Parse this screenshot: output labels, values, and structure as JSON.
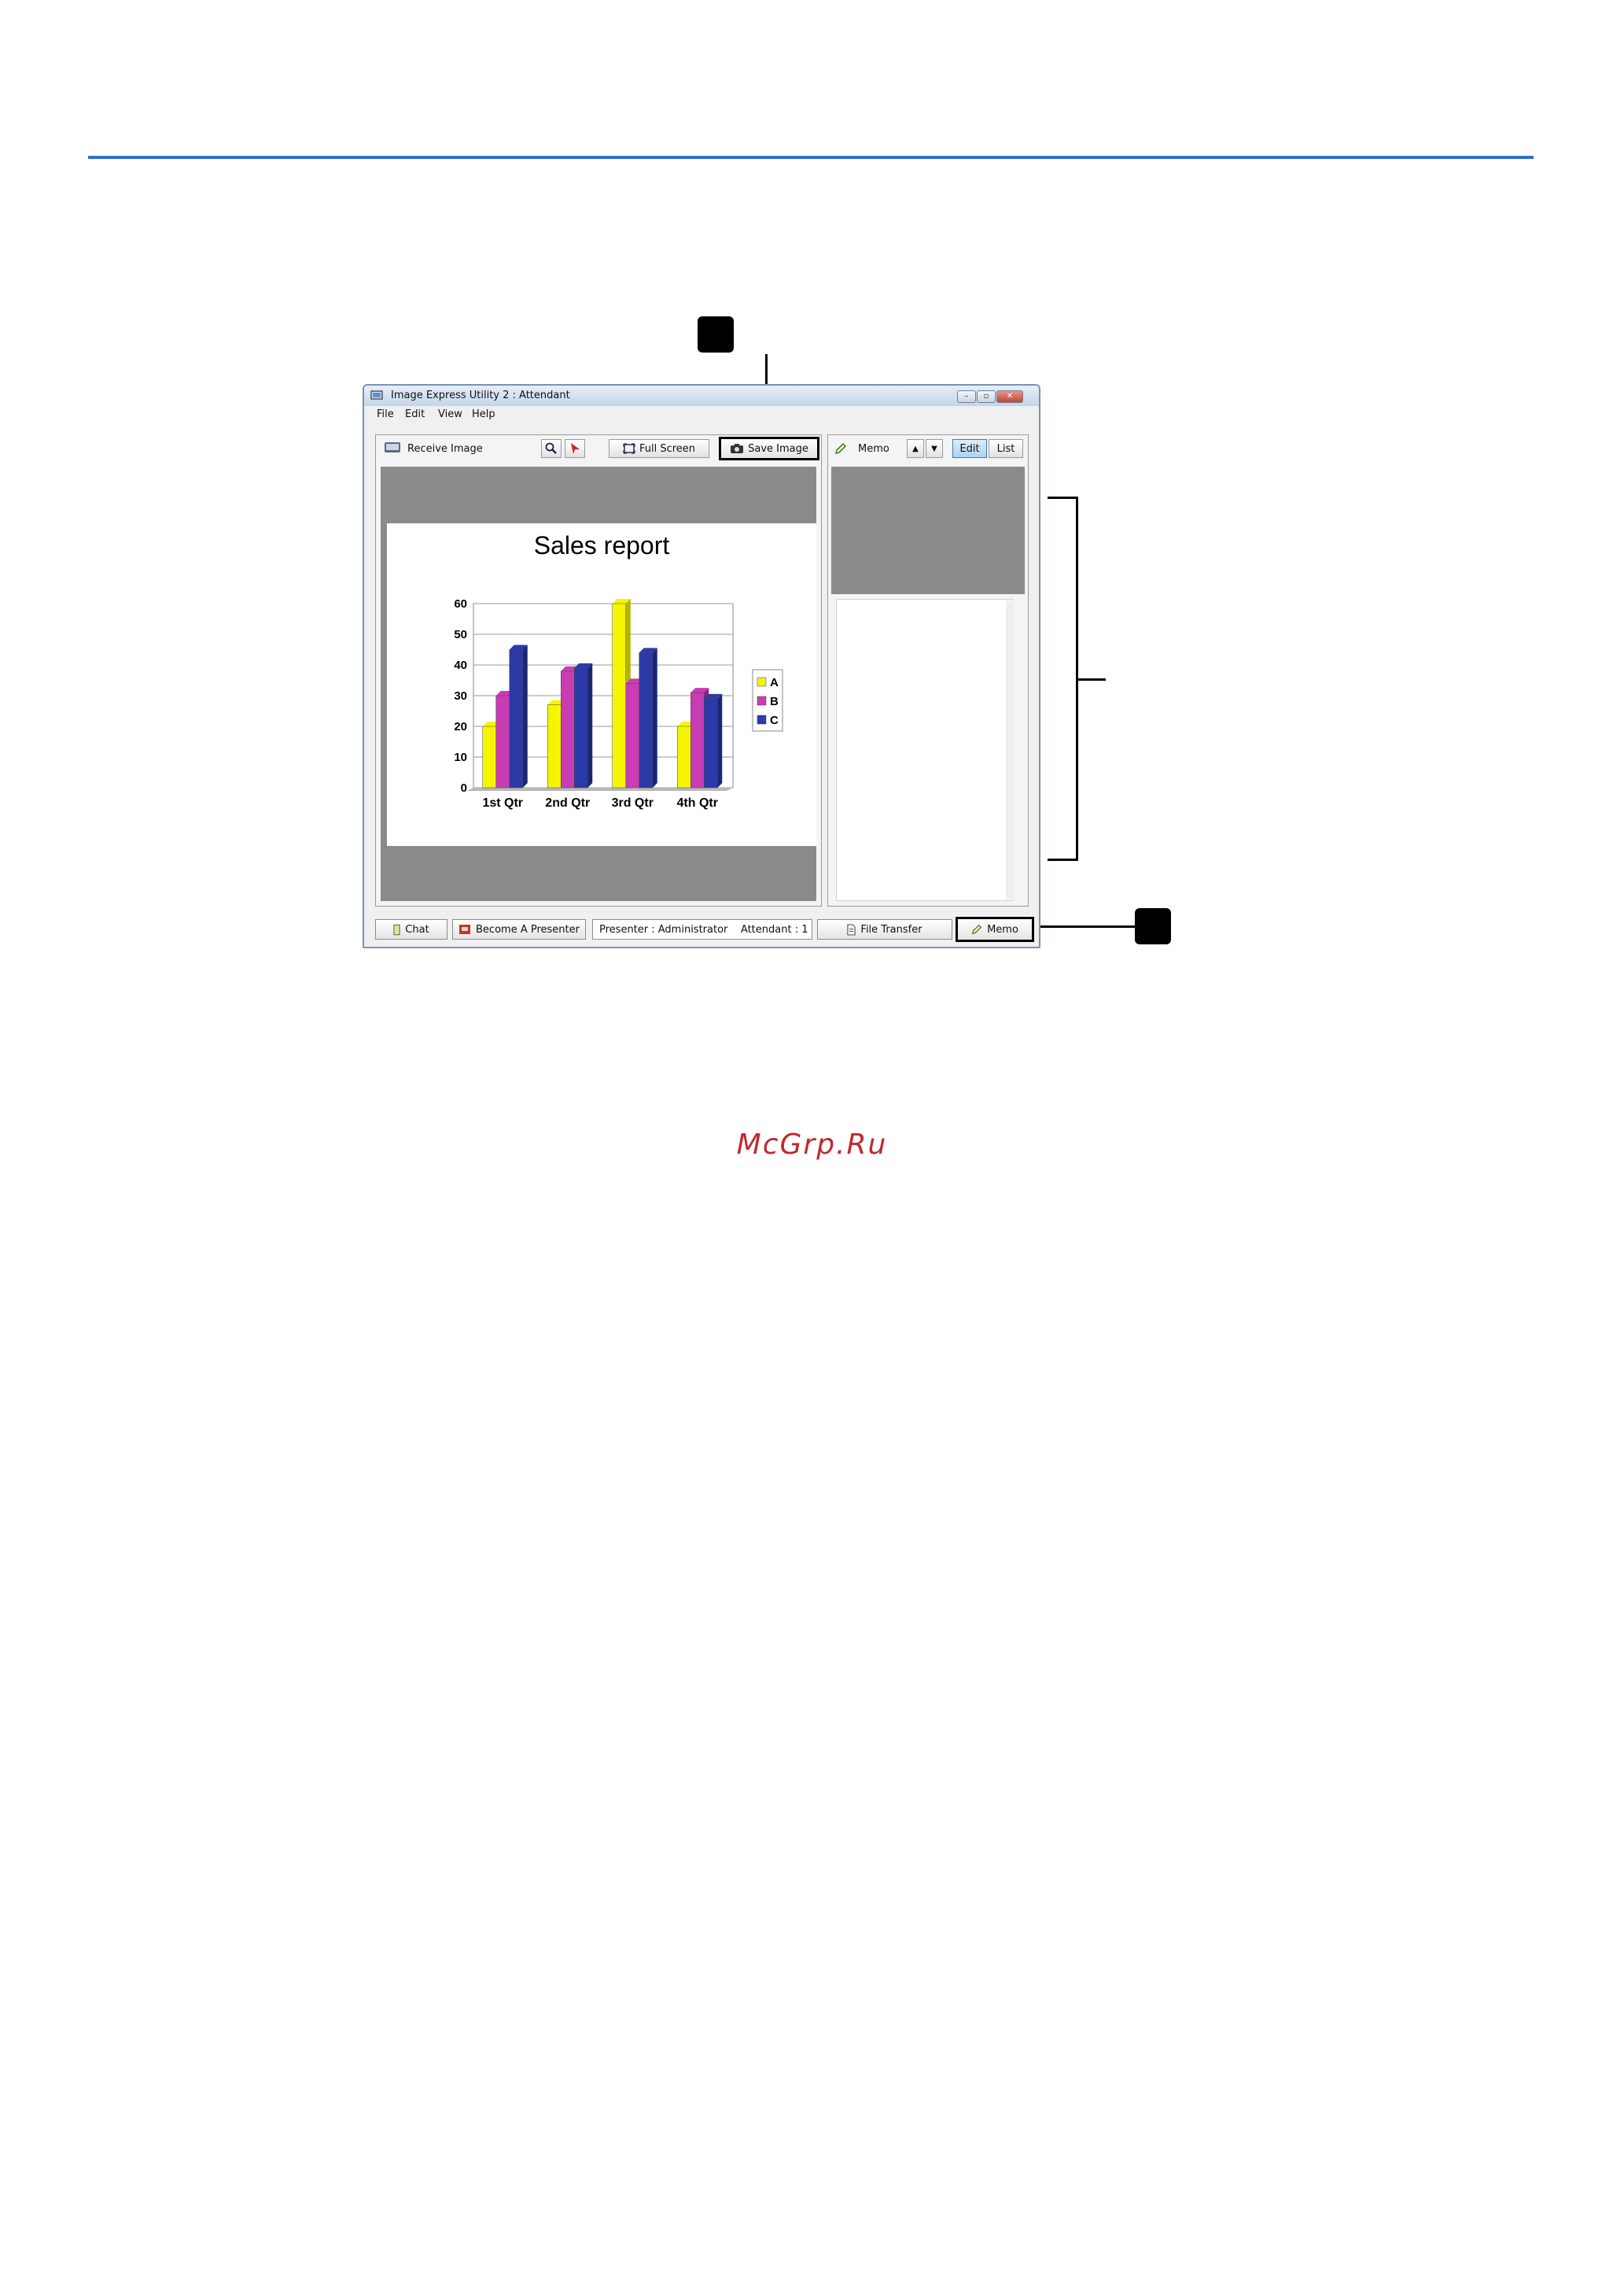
{
  "colors": {
    "rule": "#2f6fcf",
    "watermark": "#c0292f",
    "series_A": "#f5f500",
    "series_B": "#c83cb4",
    "series_C": "#2c3aa8"
  },
  "window": {
    "title": "Image Express Utility 2 : Attendant",
    "controls": [
      "minimize-icon",
      "maximize-icon",
      "close-icon"
    ]
  },
  "menu": [
    "File",
    "Edit",
    "View",
    "Help"
  ],
  "toolbar": {
    "receive_image": "Receive Image",
    "zoom_icon": "magnifier-icon",
    "pointer_icon": "pointer-arrow-icon",
    "full_screen": "Full Screen",
    "save_image": "Save Image"
  },
  "memo_panel": {
    "title": "Memo",
    "edit": "Edit",
    "list": "List"
  },
  "bottom": {
    "chat": "Chat",
    "become_presenter": "Become A Presenter",
    "status": "Presenter : Administrator    Attendant : 1",
    "file_transfer": "File Transfer",
    "memo": "Memo"
  },
  "watermark": "McGrp.Ru",
  "chart_data": {
    "type": "bar",
    "title": "Sales report",
    "categories": [
      "1st Qtr",
      "2nd Qtr",
      "3rd Qtr",
      "4th Qtr"
    ],
    "series": [
      {
        "name": "A",
        "values": [
          20,
          27,
          60,
          20
        ]
      },
      {
        "name": "B",
        "values": [
          30,
          38,
          34,
          31
        ]
      },
      {
        "name": "C",
        "values": [
          45,
          39,
          44,
          29
        ]
      }
    ],
    "ylim": [
      0,
      60
    ],
    "yticks": [
      0,
      10,
      20,
      30,
      40,
      50,
      60
    ],
    "grid": true,
    "legend": "right"
  }
}
